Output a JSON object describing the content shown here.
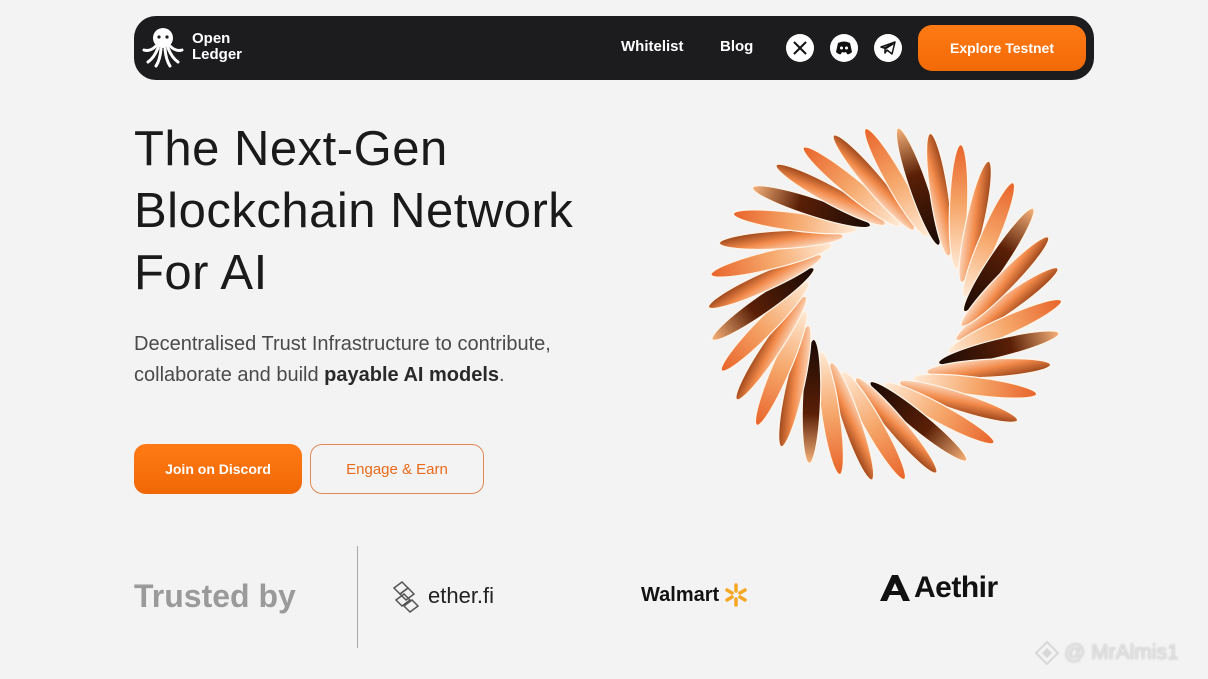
{
  "nav": {
    "logo_line1": "Open",
    "logo_line2": "Ledger",
    "links": [
      "Whitelist",
      "Blog"
    ],
    "socials": [
      "x-icon",
      "discord-icon",
      "telegram-icon"
    ],
    "cta": "Explore Testnet"
  },
  "hero": {
    "title_line1": "The Next-Gen",
    "title_line2": "Blockchain Network",
    "title_line3": "For AI",
    "sub_part1": "Decentralised Trust Infrastructure to contribute, collaborate and build ",
    "sub_bold": "payable AI models",
    "sub_end": ".",
    "primary_button": "Join on Discord",
    "secondary_button": "Engage & Earn"
  },
  "trusted": {
    "label": "Trusted by",
    "partners": [
      "ether.fi",
      "Walmart",
      "Aethir"
    ]
  },
  "watermark": "@ MrAlmis1",
  "colors": {
    "accent": "#f26a06",
    "nav_bg": "#1c1c1e",
    "page_bg": "#f3f3f3"
  }
}
